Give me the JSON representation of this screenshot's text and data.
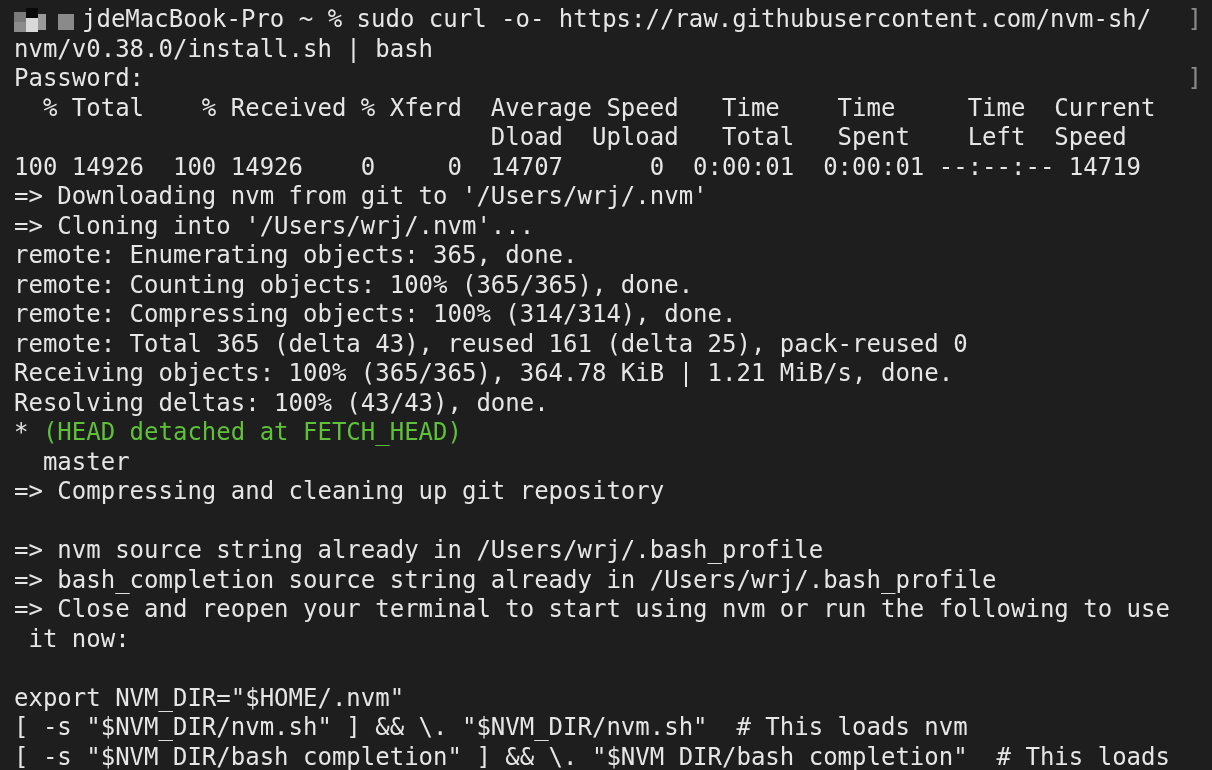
{
  "terminal": {
    "lines": [
      {
        "kind": "prompt",
        "redacted": true,
        "text": "jdeMacBook-Pro ~ % sudo curl -o- https://raw.githubusercontent.com/nvm-sh/",
        "edge_mark": "]"
      },
      {
        "kind": "plain",
        "text": "nvm/v0.38.0/install.sh | bash"
      },
      {
        "kind": "plain",
        "text": "Password:",
        "edge_mark": "]"
      },
      {
        "kind": "plain",
        "text": "  % Total    % Received % Xferd  Average Speed   Time    Time     Time  Current"
      },
      {
        "kind": "plain",
        "text": "                                 Dload  Upload   Total   Spent    Left  Speed"
      },
      {
        "kind": "plain",
        "text": "100 14926  100 14926    0     0  14707      0  0:00:01  0:00:01 --:--:-- 14719"
      },
      {
        "kind": "plain",
        "text": "=> Downloading nvm from git to '/Users/wrj/.nvm'"
      },
      {
        "kind": "plain",
        "text": "=> Cloning into '/Users/wrj/.nvm'..."
      },
      {
        "kind": "plain",
        "text": "remote: Enumerating objects: 365, done."
      },
      {
        "kind": "plain",
        "text": "remote: Counting objects: 100% (365/365), done."
      },
      {
        "kind": "plain",
        "text": "remote: Compressing objects: 100% (314/314), done."
      },
      {
        "kind": "plain",
        "text": "remote: Total 365 (delta 43), reused 161 (delta 25), pack-reused 0"
      },
      {
        "kind": "plain",
        "text": "Receiving objects: 100% (365/365), 364.78 KiB | 1.21 MiB/s, done."
      },
      {
        "kind": "plain",
        "text": "Resolving deltas: 100% (43/43), done."
      },
      {
        "kind": "branch",
        "marker": "* ",
        "text": "(HEAD detached at FETCH_HEAD)"
      },
      {
        "kind": "plain",
        "text": "  master"
      },
      {
        "kind": "plain",
        "text": "=> Compressing and cleaning up git repository"
      },
      {
        "kind": "blank"
      },
      {
        "kind": "plain",
        "text": "=> nvm source string already in /Users/wrj/.bash_profile"
      },
      {
        "kind": "plain",
        "text": "=> bash_completion source string already in /Users/wrj/.bash_profile"
      },
      {
        "kind": "plain",
        "text": "=> Close and reopen your terminal to start using nvm or run the following to use"
      },
      {
        "kind": "plain",
        "text": " it now:"
      },
      {
        "kind": "blank"
      },
      {
        "kind": "plain",
        "text": "export NVM_DIR=\"$HOME/.nvm\""
      },
      {
        "kind": "plain",
        "text": "[ -s \"$NVM_DIR/nvm.sh\" ] && \\. \"$NVM_DIR/nvm.sh\"  # This loads nvm"
      },
      {
        "kind": "plain",
        "text": "[ -s \"$NVM_DIR/bash_completion\" ] && \\. \"$NVM_DIR/bash_completion\"  # This loads"
      }
    ]
  }
}
